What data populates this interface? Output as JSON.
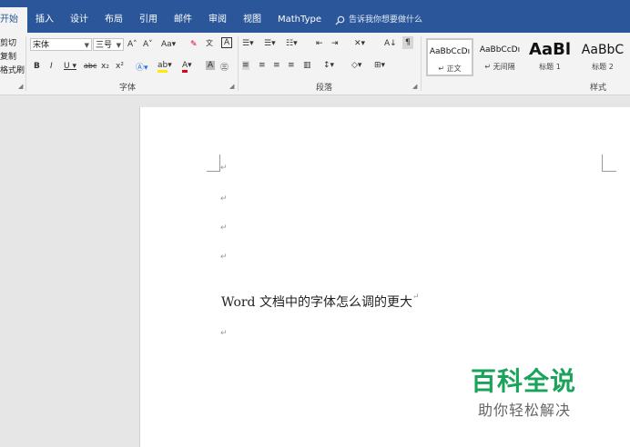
{
  "tabs": [
    "开始",
    "插入",
    "设计",
    "布局",
    "引用",
    "邮件",
    "审阅",
    "视图",
    "MathType"
  ],
  "tell_me": "告诉我你想要做什么",
  "clipboard": {
    "cut": "剪切",
    "copy": "复制",
    "format_painter": "格式刷"
  },
  "font": {
    "name": "宋体",
    "size": "三号",
    "group_label": "字体"
  },
  "paragraph": {
    "group_label": "段落"
  },
  "styles": {
    "group_label": "样式",
    "items": [
      {
        "sample": "AaBbCcDı",
        "name": "↵ 正文"
      },
      {
        "sample": "AaBbCcDı",
        "name": "↵ 无间隔"
      },
      {
        "sample": "AaBl",
        "name": "标题 1"
      },
      {
        "sample": "AaBbC",
        "name": "标题 2"
      }
    ]
  },
  "document": {
    "line": "Word 文档中的字体怎么调的更大"
  },
  "watermark": {
    "title": "百科全说",
    "subtitle": "助你轻松解决"
  },
  "colors": {
    "accent": "#2b579a",
    "watermark_green": "#1aa35a"
  }
}
